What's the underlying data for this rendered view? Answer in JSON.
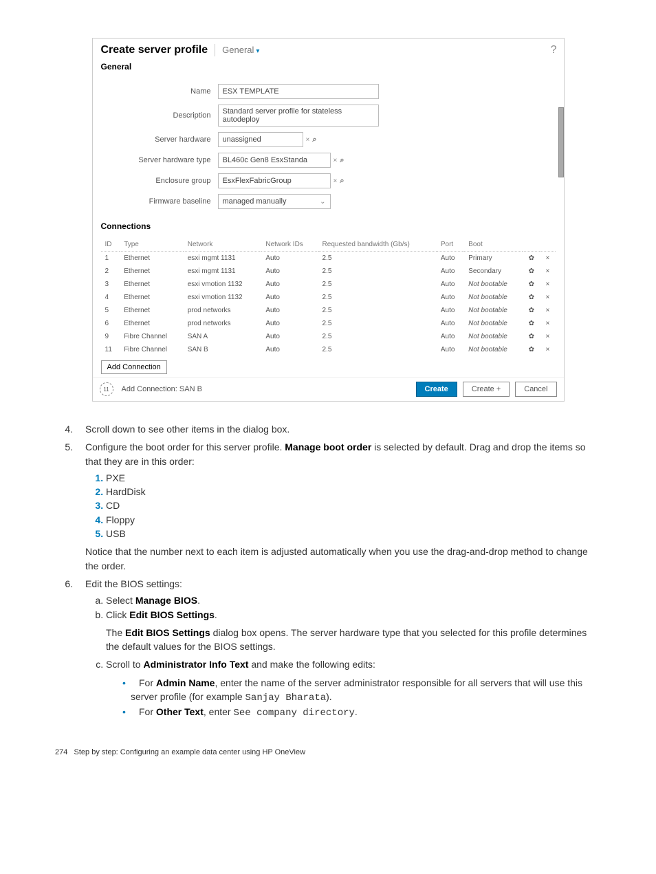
{
  "dialog": {
    "title": "Create server profile",
    "section_dropdown": "General",
    "help_icon": "?",
    "section_general": "General",
    "labels": {
      "name": "Name",
      "description": "Description",
      "server_hardware": "Server hardware",
      "server_hardware_type": "Server hardware type",
      "enclosure_group": "Enclosure group",
      "firmware_baseline": "Firmware baseline"
    },
    "values": {
      "name": "ESX TEMPLATE",
      "description": "Standard server profile for stateless autodeploy",
      "server_hardware": "unassigned",
      "server_hardware_type": "BL460c Gen8 EsxStanda",
      "enclosure_group": "EsxFlexFabricGroup",
      "firmware_baseline": "managed manually"
    },
    "section_connections": "Connections",
    "columns": {
      "id": "ID",
      "type": "Type",
      "network": "Network",
      "network_ids": "Network IDs",
      "requested_bw": "Requested bandwidth (Gb/s)",
      "port": "Port",
      "boot": "Boot"
    },
    "rows": [
      {
        "id": "1",
        "type": "Ethernet",
        "network": "esxi mgmt 1131",
        "nids": "Auto",
        "bw": "2.5",
        "port": "Auto",
        "boot": "Primary",
        "boot_italic": false
      },
      {
        "id": "2",
        "type": "Ethernet",
        "network": "esxi mgmt 1131",
        "nids": "Auto",
        "bw": "2.5",
        "port": "Auto",
        "boot": "Secondary",
        "boot_italic": false
      },
      {
        "id": "3",
        "type": "Ethernet",
        "network": "esxi vmotion 1132",
        "nids": "Auto",
        "bw": "2.5",
        "port": "Auto",
        "boot": "Not bootable",
        "boot_italic": true
      },
      {
        "id": "4",
        "type": "Ethernet",
        "network": "esxi vmotion 1132",
        "nids": "Auto",
        "bw": "2.5",
        "port": "Auto",
        "boot": "Not bootable",
        "boot_italic": true
      },
      {
        "id": "5",
        "type": "Ethernet",
        "network": "prod networks",
        "nids": "Auto",
        "bw": "2.5",
        "port": "Auto",
        "boot": "Not bootable",
        "boot_italic": true
      },
      {
        "id": "6",
        "type": "Ethernet",
        "network": "prod networks",
        "nids": "Auto",
        "bw": "2.5",
        "port": "Auto",
        "boot": "Not bootable",
        "boot_italic": true
      },
      {
        "id": "9",
        "type": "Fibre Channel",
        "network": "SAN A",
        "nids": "Auto",
        "bw": "2.5",
        "port": "Auto",
        "boot": "Not bootable",
        "boot_italic": true
      },
      {
        "id": "11",
        "type": "Fibre Channel",
        "network": "SAN B",
        "nids": "Auto",
        "bw": "2.5",
        "port": "Auto",
        "boot": "Not bootable",
        "boot_italic": true
      }
    ],
    "add_connection_btn": "Add Connection",
    "footer_badge": "11",
    "footer_status": "Add Connection: SAN B",
    "btn_create": "Create",
    "btn_create_plus": "Create +",
    "btn_cancel": "Cancel"
  },
  "doc": {
    "step4": "Scroll down to see other items in the dialog box.",
    "step5_a": "Configure the boot order for this server profile. ",
    "step5_b": "Manage boot order",
    "step5_c": " is selected by default. Drag and drop the items so that they are in this order:",
    "boot_items": [
      "PXE",
      "HardDisk",
      "CD",
      "Floppy",
      "USB"
    ],
    "step5_note": "Notice that the number next to each item is adjusted automatically when you use the drag-and-drop method to change the order.",
    "step6": "Edit the BIOS settings:",
    "step6a_pre": "Select ",
    "step6a_b": "Manage BIOS",
    "step6a_post": ".",
    "step6b_pre": "Click ",
    "step6b_b": "Edit BIOS Settings",
    "step6b_post": ".",
    "step6b_follow1_pre": "The ",
    "step6b_follow1_b": "Edit BIOS Settings",
    "step6b_follow1_post": " dialog box opens. The server hardware type that you selected for this profile determines the default values for the BIOS settings.",
    "step6c_pre": "Scroll to ",
    "step6c_b": "Administrator Info Text",
    "step6c_post": " and make the following edits:",
    "bul1_pre": "For ",
    "bul1_b": "Admin Name",
    "bul1_mid": ", enter the name of the server administrator responsible for all servers that will use this server profile (for example ",
    "bul1_code": "Sanjay Bharata",
    "bul1_post": ").",
    "bul2_pre": "For ",
    "bul2_b": "Other Text",
    "bul2_mid": ", enter ",
    "bul2_code": "See company directory",
    "bul2_post": ".",
    "footer_page": "274",
    "footer_text": "Step by step: Configuring an example data center using HP OneView"
  }
}
